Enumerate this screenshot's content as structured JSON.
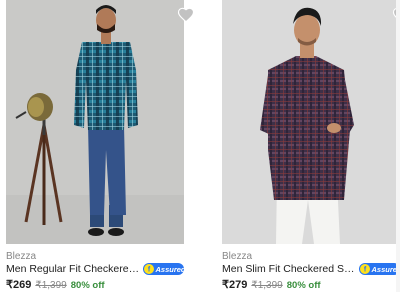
{
  "products": [
    {
      "brand": "Blezza",
      "title": "Men Regular Fit Checkered Spread Collar Casual Shirt",
      "assured": "Assured",
      "price": "₹269",
      "mrp": "₹1,399",
      "discount": "80% off",
      "shirt_color": "#1f5f78",
      "icon": "heart-icon"
    },
    {
      "brand": "Blezza",
      "title": "Men Slim Fit Checkered Spread Collar Casual Shirt",
      "assured": "Assured",
      "price": "₹279",
      "mrp": "₹1,399",
      "discount": "80% off",
      "shirt_color": "#4a3550",
      "icon": "heart-icon"
    }
  ],
  "colors": {
    "discount": "#388e3c",
    "assured_blue": "#2874f0",
    "assured_yellow": "#ffe11b"
  }
}
